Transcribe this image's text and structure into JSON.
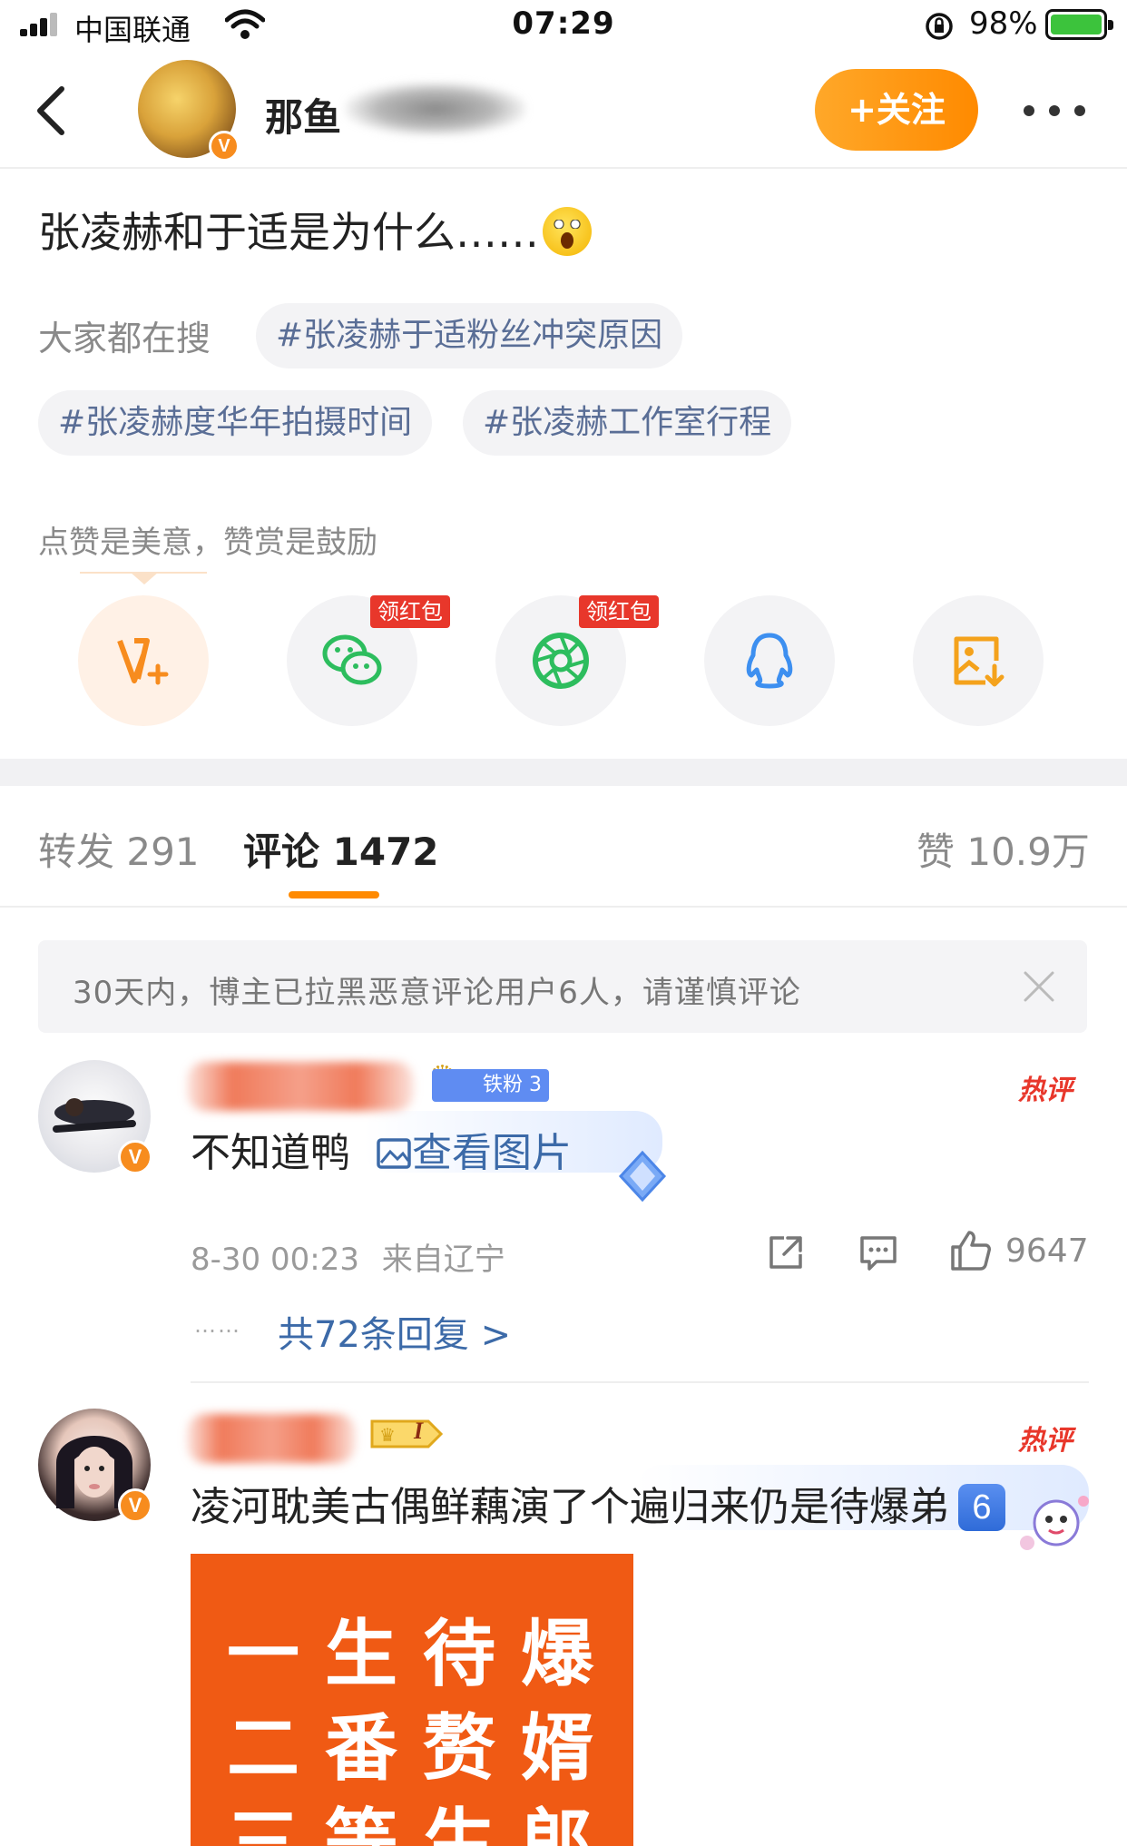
{
  "status_bar": {
    "carrier": "中国联通",
    "time": "07:29",
    "battery": "98%"
  },
  "nav": {
    "user_name": "那鱼",
    "follow_label": "+关注"
  },
  "post": {
    "text": "张凌赫和于适是为什么……",
    "search_label": "大家都在搜",
    "tags": [
      "#张凌赫于适粉丝冲突原因",
      "#张凌赫度华年拍摄时间",
      "#张凌赫工作室行程"
    ]
  },
  "reward": {
    "text": "点赞是美意，赞赏是鼓励",
    "share_targets": [
      {
        "icon": "weibo-reward-icon",
        "badge": ""
      },
      {
        "icon": "wechat-icon",
        "badge": "领红包"
      },
      {
        "icon": "moments-icon",
        "badge": "领红包"
      },
      {
        "icon": "qq-icon",
        "badge": ""
      },
      {
        "icon": "save-image-icon",
        "badge": ""
      }
    ]
  },
  "tabs": {
    "repost": "转发 291",
    "comments": "评论 1472",
    "likes": "赞 10.9万"
  },
  "notice": {
    "text": "30天内，博主已拉黑恶意评论用户6人，请谨慎评论"
  },
  "comments": [
    {
      "fan_badge": "铁粉 3",
      "hot": "热评",
      "text": "不知道鸭",
      "link": "查看图片",
      "time": "8-30 00:23",
      "location": "来自辽宁",
      "likes": "9647",
      "replies": "共72条回复 >",
      "reply_dots": "……"
    },
    {
      "level": "I",
      "hot": "热评",
      "text": "凌河耽美古偶鲜藕演了个遍归来仍是待爆弟",
      "number_badge": "6",
      "poster_lines": [
        "一生待爆",
        "二番赘婿",
        "三等生郎"
      ]
    }
  ],
  "colors": {
    "accent": "#ff8a00",
    "link": "#3c6aa8",
    "hot": "#e8372b",
    "fan_badge": "#5f8cf2"
  }
}
